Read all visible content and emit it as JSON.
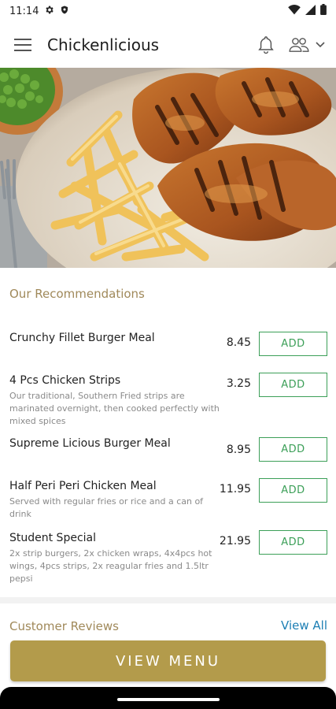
{
  "status_bar": {
    "time": "11:14"
  },
  "app_bar": {
    "title": "Chickenlicious"
  },
  "recommendations": {
    "title": "Our Recommendations",
    "items": [
      {
        "name": "Crunchy Fillet Burger Meal",
        "desc": "",
        "price": "8.45",
        "button": "ADD"
      },
      {
        "name": "4 Pcs Chicken Strips",
        "desc": "Our traditional, Southern Fried strips are marinated overnight, then cooked perfectly with mixed spices",
        "price": "3.25",
        "button": "ADD"
      },
      {
        "name": "Supreme Licious Burger Meal",
        "desc": "",
        "price": "8.95",
        "button": "ADD"
      },
      {
        "name": "Half Peri Peri Chicken Meal",
        "desc": "Served with regular fries or rice and a can of drink",
        "price": "11.95",
        "button": "ADD"
      },
      {
        "name": "Student Special",
        "desc": "2x strip burgers, 2x chicken wraps, 4x4pcs hot wings, 4pcs strips, 2x reagular fries and 1.5ltr pepsi",
        "price": "21.95",
        "button": "ADD"
      }
    ]
  },
  "reviews": {
    "title": "Customer Reviews",
    "view_all": "View All"
  },
  "footer": {
    "view_menu_label": "VIEW MENU"
  },
  "colors": {
    "accent_gold": "#b39b4b",
    "section_title": "#a0895a",
    "add_green": "#3c9f58",
    "link_blue": "#1d7fb4"
  },
  "icons": [
    "settings-icon",
    "shield-icon",
    "wifi-icon",
    "signal-icon",
    "battery-icon",
    "menu-icon",
    "bell-icon",
    "users-icon",
    "chevron-down-icon"
  ]
}
